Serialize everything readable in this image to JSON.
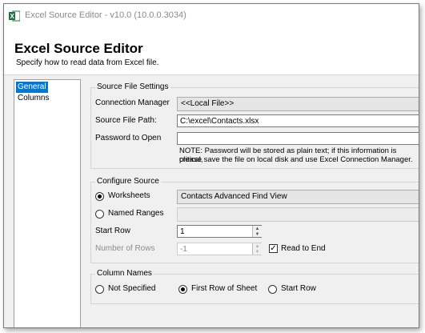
{
  "window": {
    "title": "Excel Source Editor - v10.0 (10.0.0.3034)"
  },
  "header": {
    "title": "Excel Source Editor",
    "subtitle": "Specify how to read data from Excel file."
  },
  "nav": {
    "items": [
      {
        "label": "General",
        "selected": true
      },
      {
        "label": "Columns",
        "selected": false
      }
    ]
  },
  "source_file_settings": {
    "group_title": "Source File Settings",
    "connection_manager_label": "Connection Manager",
    "connection_manager_value": "<<Local File>>",
    "source_file_path_label": "Source File Path:",
    "source_file_path_value": "C:\\excel\\Contacts.xlsx",
    "password_label": "Password to Open",
    "password_value": "",
    "note_line1": "NOTE: Password will be stored as plain text; if this information is critical,",
    "note_line2": "please save the file on local disk and use Excel Connection Manager."
  },
  "configure_source": {
    "group_title": "Configure Source",
    "worksheets_label": "Worksheets",
    "worksheets_value": "Contacts Advanced Find View",
    "named_ranges_label": "Named Ranges",
    "named_ranges_value": "",
    "start_row_label": "Start Row",
    "start_row_value": "1",
    "number_of_rows_label": "Number of Rows",
    "number_of_rows_value": "-1",
    "read_to_end_label": "Read to End",
    "read_to_end_checked": true,
    "selected_source": "Worksheets"
  },
  "column_names": {
    "group_title": "Column Names",
    "options": [
      {
        "label": "Not Specified"
      },
      {
        "label": "First Row of Sheet"
      },
      {
        "label": "Start Row"
      }
    ],
    "selected": "First Row of Sheet"
  },
  "colors": {
    "accent": "#0078d7",
    "excel_green": "#1e7145"
  }
}
